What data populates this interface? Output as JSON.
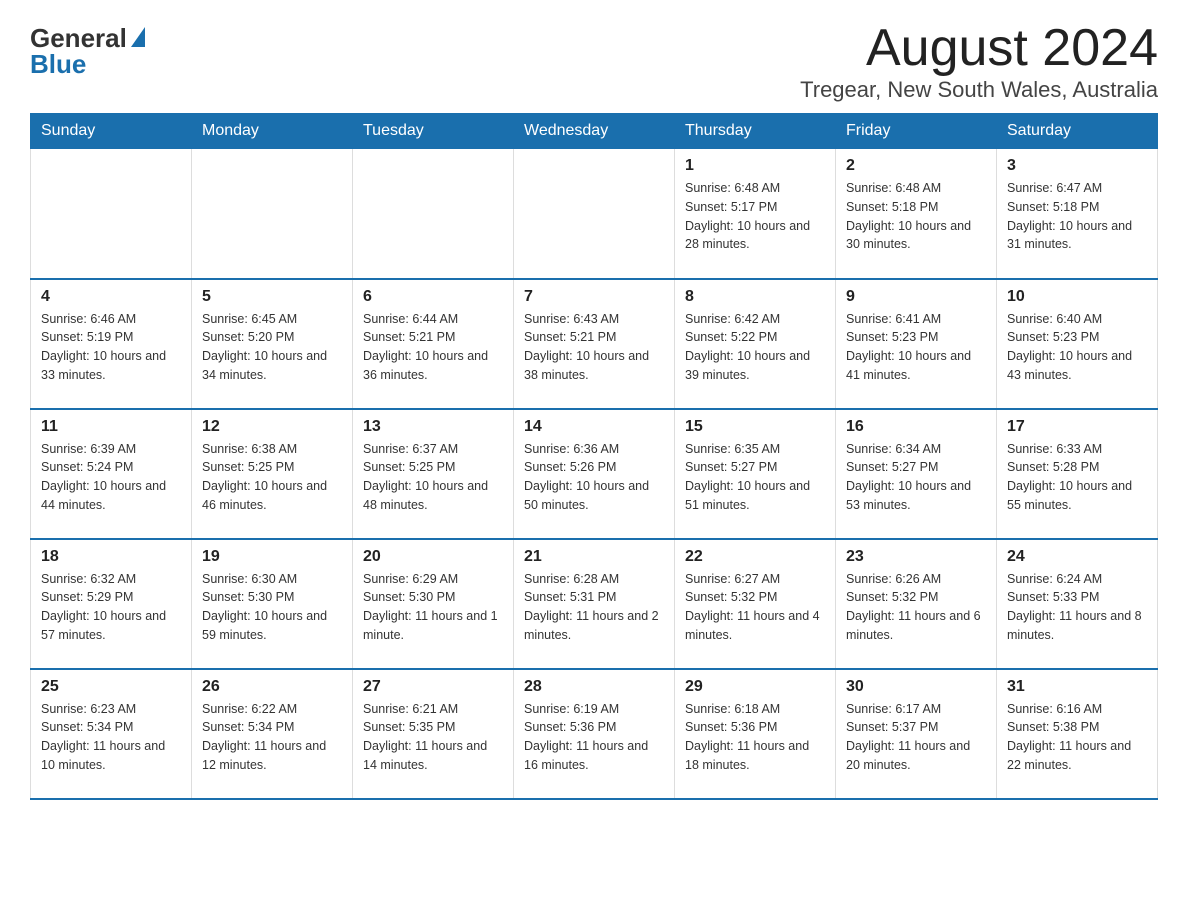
{
  "header": {
    "logo_general": "General",
    "logo_blue": "Blue",
    "month_title": "August 2024",
    "location": "Tregear, New South Wales, Australia"
  },
  "days_of_week": [
    "Sunday",
    "Monday",
    "Tuesday",
    "Wednesday",
    "Thursday",
    "Friday",
    "Saturday"
  ],
  "weeks": [
    [
      {
        "day": "",
        "info": ""
      },
      {
        "day": "",
        "info": ""
      },
      {
        "day": "",
        "info": ""
      },
      {
        "day": "",
        "info": ""
      },
      {
        "day": "1",
        "info": "Sunrise: 6:48 AM\nSunset: 5:17 PM\nDaylight: 10 hours and 28 minutes."
      },
      {
        "day": "2",
        "info": "Sunrise: 6:48 AM\nSunset: 5:18 PM\nDaylight: 10 hours and 30 minutes."
      },
      {
        "day": "3",
        "info": "Sunrise: 6:47 AM\nSunset: 5:18 PM\nDaylight: 10 hours and 31 minutes."
      }
    ],
    [
      {
        "day": "4",
        "info": "Sunrise: 6:46 AM\nSunset: 5:19 PM\nDaylight: 10 hours and 33 minutes."
      },
      {
        "day": "5",
        "info": "Sunrise: 6:45 AM\nSunset: 5:20 PM\nDaylight: 10 hours and 34 minutes."
      },
      {
        "day": "6",
        "info": "Sunrise: 6:44 AM\nSunset: 5:21 PM\nDaylight: 10 hours and 36 minutes."
      },
      {
        "day": "7",
        "info": "Sunrise: 6:43 AM\nSunset: 5:21 PM\nDaylight: 10 hours and 38 minutes."
      },
      {
        "day": "8",
        "info": "Sunrise: 6:42 AM\nSunset: 5:22 PM\nDaylight: 10 hours and 39 minutes."
      },
      {
        "day": "9",
        "info": "Sunrise: 6:41 AM\nSunset: 5:23 PM\nDaylight: 10 hours and 41 minutes."
      },
      {
        "day": "10",
        "info": "Sunrise: 6:40 AM\nSunset: 5:23 PM\nDaylight: 10 hours and 43 minutes."
      }
    ],
    [
      {
        "day": "11",
        "info": "Sunrise: 6:39 AM\nSunset: 5:24 PM\nDaylight: 10 hours and 44 minutes."
      },
      {
        "day": "12",
        "info": "Sunrise: 6:38 AM\nSunset: 5:25 PM\nDaylight: 10 hours and 46 minutes."
      },
      {
        "day": "13",
        "info": "Sunrise: 6:37 AM\nSunset: 5:25 PM\nDaylight: 10 hours and 48 minutes."
      },
      {
        "day": "14",
        "info": "Sunrise: 6:36 AM\nSunset: 5:26 PM\nDaylight: 10 hours and 50 minutes."
      },
      {
        "day": "15",
        "info": "Sunrise: 6:35 AM\nSunset: 5:27 PM\nDaylight: 10 hours and 51 minutes."
      },
      {
        "day": "16",
        "info": "Sunrise: 6:34 AM\nSunset: 5:27 PM\nDaylight: 10 hours and 53 minutes."
      },
      {
        "day": "17",
        "info": "Sunrise: 6:33 AM\nSunset: 5:28 PM\nDaylight: 10 hours and 55 minutes."
      }
    ],
    [
      {
        "day": "18",
        "info": "Sunrise: 6:32 AM\nSunset: 5:29 PM\nDaylight: 10 hours and 57 minutes."
      },
      {
        "day": "19",
        "info": "Sunrise: 6:30 AM\nSunset: 5:30 PM\nDaylight: 10 hours and 59 minutes."
      },
      {
        "day": "20",
        "info": "Sunrise: 6:29 AM\nSunset: 5:30 PM\nDaylight: 11 hours and 1 minute."
      },
      {
        "day": "21",
        "info": "Sunrise: 6:28 AM\nSunset: 5:31 PM\nDaylight: 11 hours and 2 minutes."
      },
      {
        "day": "22",
        "info": "Sunrise: 6:27 AM\nSunset: 5:32 PM\nDaylight: 11 hours and 4 minutes."
      },
      {
        "day": "23",
        "info": "Sunrise: 6:26 AM\nSunset: 5:32 PM\nDaylight: 11 hours and 6 minutes."
      },
      {
        "day": "24",
        "info": "Sunrise: 6:24 AM\nSunset: 5:33 PM\nDaylight: 11 hours and 8 minutes."
      }
    ],
    [
      {
        "day": "25",
        "info": "Sunrise: 6:23 AM\nSunset: 5:34 PM\nDaylight: 11 hours and 10 minutes."
      },
      {
        "day": "26",
        "info": "Sunrise: 6:22 AM\nSunset: 5:34 PM\nDaylight: 11 hours and 12 minutes."
      },
      {
        "day": "27",
        "info": "Sunrise: 6:21 AM\nSunset: 5:35 PM\nDaylight: 11 hours and 14 minutes."
      },
      {
        "day": "28",
        "info": "Sunrise: 6:19 AM\nSunset: 5:36 PM\nDaylight: 11 hours and 16 minutes."
      },
      {
        "day": "29",
        "info": "Sunrise: 6:18 AM\nSunset: 5:36 PM\nDaylight: 11 hours and 18 minutes."
      },
      {
        "day": "30",
        "info": "Sunrise: 6:17 AM\nSunset: 5:37 PM\nDaylight: 11 hours and 20 minutes."
      },
      {
        "day": "31",
        "info": "Sunrise: 6:16 AM\nSunset: 5:38 PM\nDaylight: 11 hours and 22 minutes."
      }
    ]
  ]
}
